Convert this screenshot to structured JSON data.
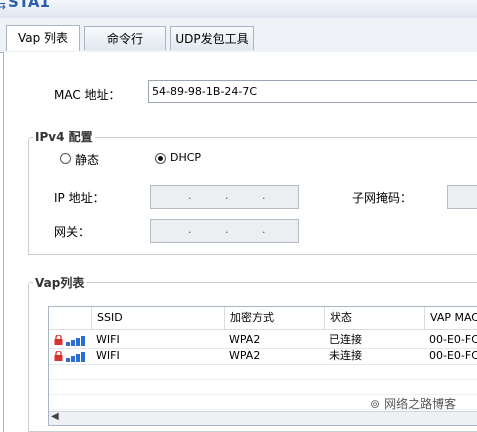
{
  "window": {
    "title": "STA1"
  },
  "tabs": [
    {
      "label": "Vap 列表",
      "active": true
    },
    {
      "label": "命令行",
      "active": false
    },
    {
      "label": "UDP发包工具",
      "active": false
    }
  ],
  "mac": {
    "label": "MAC 地址：",
    "value": "54-89-98-1B-24-7C"
  },
  "ipv4": {
    "group_title": "IPv4 配置",
    "static_label": "静态",
    "dhcp_label": "DHCP",
    "selected": "DHCP",
    "ip_label": "IP 地址：",
    "mask_label": "子网掩码：",
    "gateway_label": "网关："
  },
  "vap": {
    "group_title": "Vap列表",
    "columns": [
      "SSID",
      "加密方式",
      "状态",
      "VAP MAC"
    ],
    "rows": [
      {
        "ssid": "WIFI",
        "encryption": "WPA2",
        "status": "已连接",
        "mac": "00-E0-FC-"
      },
      {
        "ssid": "WIFI",
        "encryption": "WPA2",
        "status": "未连接",
        "mac": "00-E0-FC-"
      }
    ]
  },
  "watermark": {
    "text": "网络之路博客"
  },
  "colors": {
    "accent": "#2a6ed8",
    "lock": "#d9312b",
    "border": "#a9b5c4"
  },
  "icons": {
    "lock": "lock-icon",
    "signal": "signal-bars-icon",
    "scroll_left": "chevron-left-icon"
  }
}
